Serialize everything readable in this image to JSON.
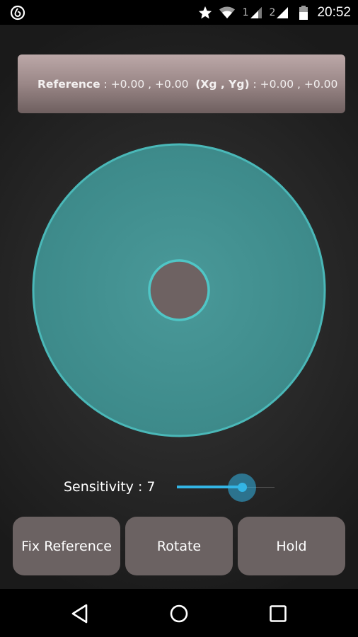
{
  "status_bar": {
    "left_icon": "app-notification-icon",
    "icons": [
      "star-icon",
      "wifi-icon",
      "signal-sim1-icon",
      "signal-sim2-icon",
      "battery-icon"
    ],
    "sim1_label": "1",
    "sim2_label": "2",
    "time": "20:52"
  },
  "reference_panel": {
    "reference_label": "Reference",
    "separator": " : ",
    "reference_value": "+0.00 , +0.00",
    "xy_label": "(Xg , Yg)",
    "xy_value": "+0.00 , +0.00"
  },
  "pad": {
    "outer_color": "#3f8e8e",
    "outer_border_color": "#4ab8b8",
    "inner_color": "#6e6262",
    "inner_border_color": "#4fc6c6",
    "indicator_x": 0.0,
    "indicator_y": 0.0
  },
  "sensitivity": {
    "label": "Sensitivity : 7",
    "value": 7,
    "min": 1,
    "max": 10,
    "accent_color": "#33b5e5"
  },
  "buttons": {
    "fix_reference": "Fix Reference",
    "rotate": "Rotate",
    "hold": "Hold"
  },
  "nav_bar": {
    "back": "back-icon",
    "home": "home-icon",
    "recents": "recents-icon"
  }
}
